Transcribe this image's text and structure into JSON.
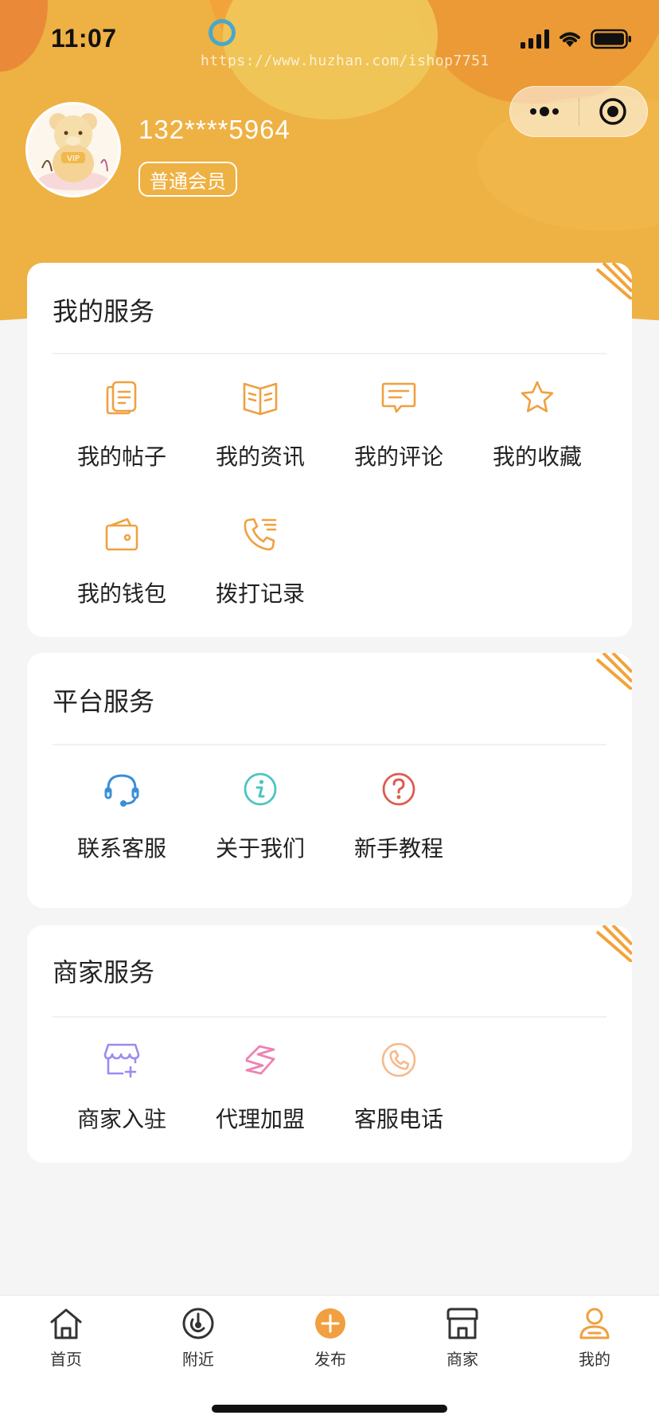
{
  "status_bar": {
    "time": "11:07"
  },
  "watermark": "https://www.huzhan.com/ishop7751",
  "capsule": {
    "more_icon": "more-dots-icon",
    "close_icon": "target-circle-icon"
  },
  "user": {
    "phone": "132****5964",
    "member_level": "普通会员",
    "avatar_badge_text": "VIP"
  },
  "my_services": {
    "title": "我的服务",
    "items": [
      {
        "label": "我的帖子",
        "icon": "posts-icon"
      },
      {
        "label": "我的资讯",
        "icon": "news-book-icon"
      },
      {
        "label": "我的评论",
        "icon": "comment-icon"
      },
      {
        "label": "我的收藏",
        "icon": "star-icon"
      },
      {
        "label": "我的钱包",
        "icon": "wallet-icon"
      },
      {
        "label": "拨打记录",
        "icon": "call-log-icon"
      }
    ]
  },
  "platform_services": {
    "title": "平台服务",
    "items": [
      {
        "label": "联系客服",
        "icon": "headset-icon"
      },
      {
        "label": "关于我们",
        "icon": "info-icon"
      },
      {
        "label": "新手教程",
        "icon": "question-icon"
      }
    ]
  },
  "merchant_services": {
    "title": "商家服务",
    "items": [
      {
        "label": "商家入驻",
        "icon": "store-add-icon"
      },
      {
        "label": "代理加盟",
        "icon": "agent-icon"
      },
      {
        "label": "客服电话",
        "icon": "phone-icon"
      }
    ]
  },
  "tabbar": {
    "items": [
      {
        "label": "首页",
        "icon": "home-icon"
      },
      {
        "label": "附近",
        "icon": "nearby-icon"
      },
      {
        "label": "发布",
        "icon": "publish-plus-icon"
      },
      {
        "label": "商家",
        "icon": "shop-icon"
      },
      {
        "label": "我的",
        "icon": "profile-icon"
      }
    ],
    "active": "我的"
  },
  "colors": {
    "header_bg": "#eeb143",
    "icon_orange": "#f0a040",
    "headset_blue": "#3a8fd6",
    "info_teal": "#4cc4c0",
    "question_red": "#e05a4e",
    "store_purple": "#9a8cf0",
    "agent_pink": "#ee82b4",
    "phone_peach": "#f6b98a",
    "tab_active": "#f0a040"
  }
}
